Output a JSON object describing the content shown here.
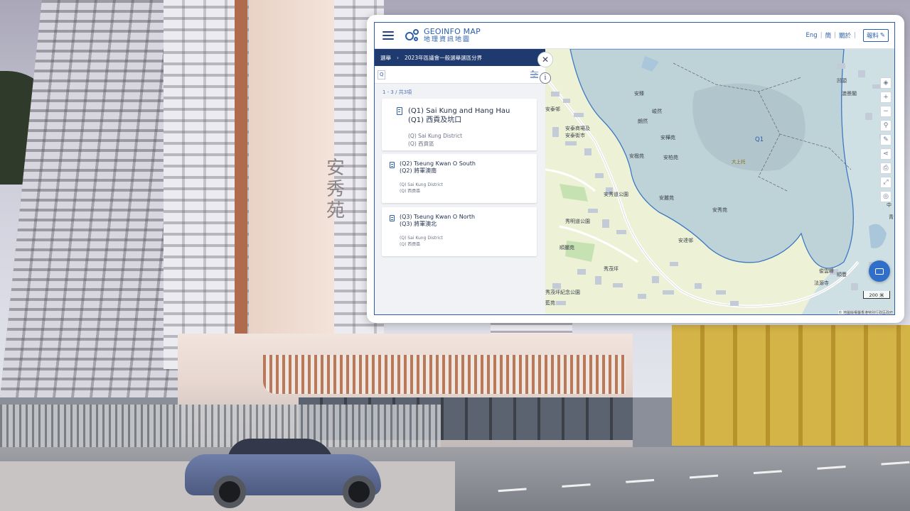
{
  "app": {
    "logo_en": "GEOINFO MAP",
    "logo_zh": "地理資訊地圖"
  },
  "header": {
    "lang_en": "Eng",
    "lang_sc": "簡",
    "contact": "關於",
    "report_label": "報料"
  },
  "breadcrumb": {
    "root": "選舉",
    "current": "2023年區議會一般選舉選區分界"
  },
  "search": {
    "value": "Q"
  },
  "results": {
    "count_text": "1 - 3 / 共3項",
    "items": [
      {
        "title_en": "(Q1) Sai Kung and Hang Hau",
        "title_zh": "(Q1) 西貢及坑口",
        "district_en": "(Q) Sai Kung District",
        "district_zh": "(Q) 西貢區"
      },
      {
        "title_en": "(Q2) Tseung Kwan O South",
        "title_zh": "(Q2) 將軍澳南",
        "district_en": "(Q) Sai Kung District",
        "district_zh": "(Q) 西貢區"
      },
      {
        "title_en": "(Q3) Tseung Kwan O North",
        "title_zh": "(Q3) 將軍澳北",
        "district_en": "(Q) Sai Kung District",
        "district_zh": "(Q) 西貢區"
      }
    ]
  },
  "map": {
    "labels": {
      "anshi": "安泰邨",
      "shopping": "安泰商場及",
      "market": "安泰街市",
      "anzhen": "安臻",
      "juntai": "峻然",
      "langran": "朗然",
      "anlinyuan": "安樺苑",
      "anyingyuan": "安楹苑",
      "anboyuan": "安柏苑",
      "anxiupark": "安秀道公園",
      "xiumingpark": "秀明道公園",
      "anliyuan": "安麗苑",
      "anxiuyuan": "安秀苑",
      "anda": "安達邨",
      "shunliyuan": "順麗苑",
      "xiumaoping": "秀茂坪",
      "jinianpark": "秀茂坪紀念公園",
      "lanyuan": "藍苑",
      "aoling": "凹頭",
      "aojinglan": "澳景閣",
      "zhong": "中",
      "qing": "青",
      "junxiu": "俊雲峰",
      "shunli": "順豐",
      "fayusi": "法源寺",
      "q1": "Q1",
      "hill": "大上托"
    },
    "scale": "200 米",
    "attribution": "© 地圖版權屬香港特別行政區政府"
  },
  "scene": {
    "sign": "安秀苑"
  },
  "colors": {
    "brand": "#2c5fa8",
    "breadcrumb_bg": "#1e3a6e",
    "district_fill": "#b8cfd8",
    "land": "#edf2d7",
    "chat_button": "#2f6fc9"
  }
}
